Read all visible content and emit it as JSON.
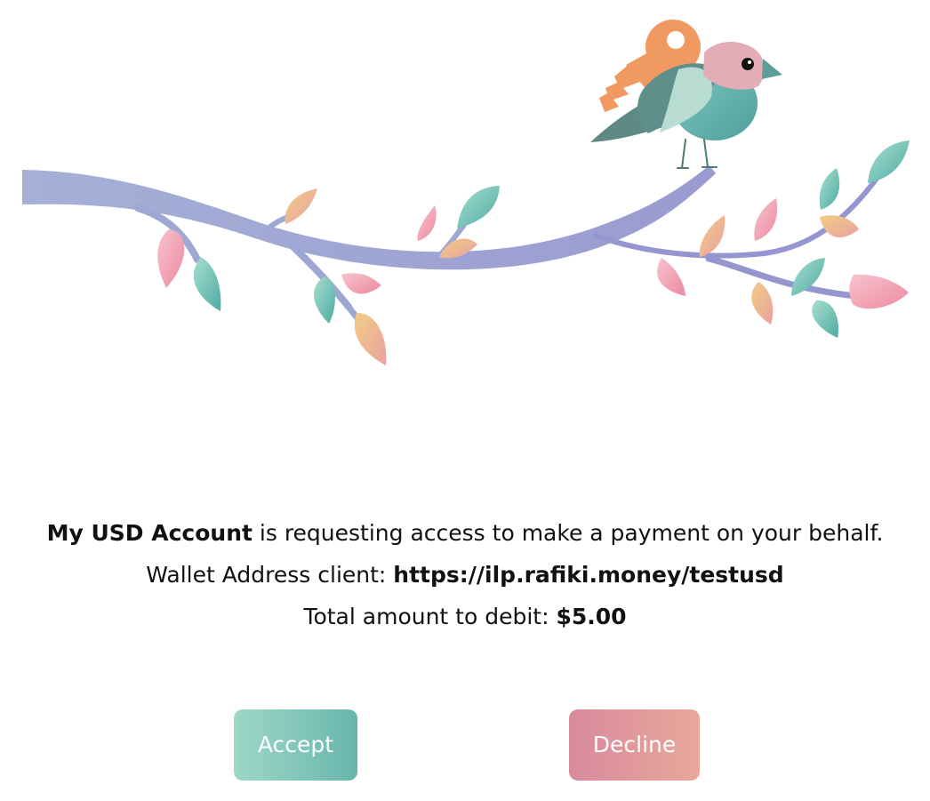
{
  "consent": {
    "requester_name": "My USD Account",
    "requester_suffix": " is requesting access to make a payment on your behalf.",
    "wallet_label": "Wallet Address client: ",
    "wallet_address": "https://ilp.rafiki.money/testusd",
    "debit_label": "Total amount to debit: ",
    "debit_amount": "$5.00"
  },
  "actions": {
    "accept_label": "Accept",
    "decline_label": "Decline"
  },
  "illustration": {
    "name": "bird-on-branch-with-key",
    "colors": {
      "branch": "#9ea9d4",
      "bird_body": "#67b5b1",
      "bird_head": "#e3adb7",
      "key": "#f09a61",
      "wing_dark": "#5d8e86",
      "leaf_teal": "#6bc3b7",
      "leaf_pink": "#f4a7b8",
      "leaf_orange": "#edbc78"
    }
  }
}
